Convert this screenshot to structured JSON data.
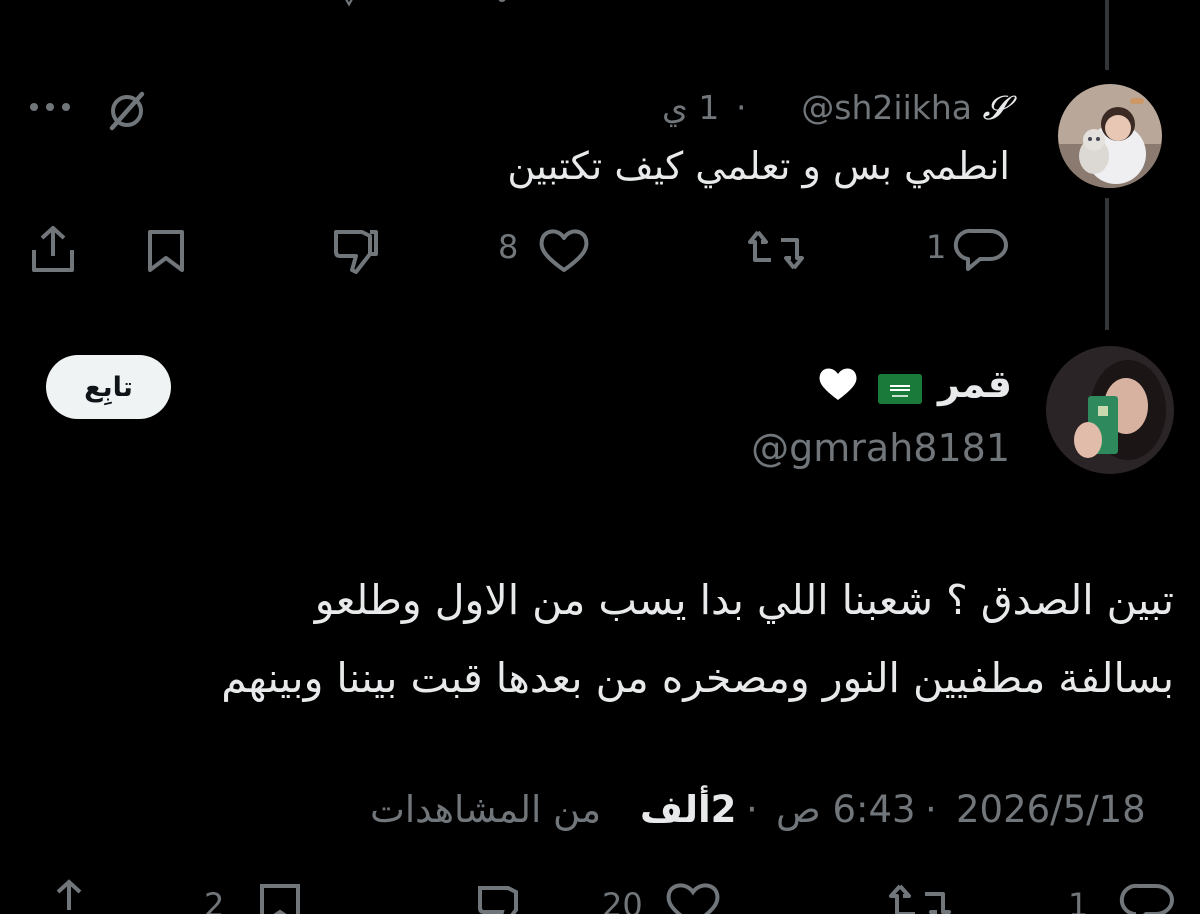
{
  "reply": {
    "name_icon": "gothic-s-glyph",
    "handle": "@sh2iikha",
    "separator": "·",
    "time": "1 ي",
    "text": "انطمي بس و تعلمي كيف تكتبين",
    "stats": {
      "replies": "1",
      "likes": "8"
    }
  },
  "main": {
    "display_name": "قمر",
    "name_emojis": [
      "saudi-flag",
      "white-heart"
    ],
    "handle": "@gmrah8181",
    "follow_label": "تابِع",
    "text_line1": "تبين الصدق ؟ شعبنا اللي بدا يسب من الاول وطلعو",
    "text_line2": "بسالفة مطفيين النور ومصخره من بعدها قبت بيننا وبينهم",
    "meta": {
      "date": "2026/5/18",
      "dot": "·",
      "time": "6:43 ص",
      "views_count": "2ألف",
      "views_label": "من المشاهدات"
    },
    "stats": {
      "replies": "1",
      "likes": "20",
      "bookmarks": "2"
    }
  },
  "colors": {
    "background": "#000000",
    "text": "#e7e9ea",
    "muted": "#71767b",
    "divider": "#333639"
  }
}
